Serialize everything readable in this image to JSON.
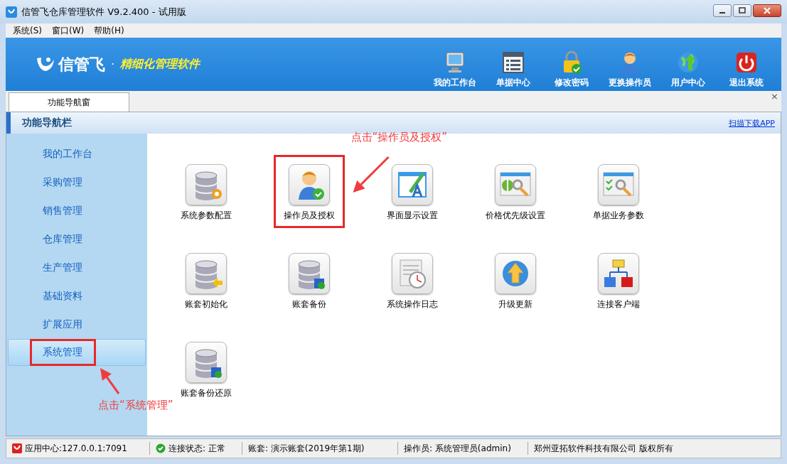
{
  "window": {
    "title": "信管飞仓库管理软件 V9.2.400 - 试用版"
  },
  "menu": [
    "系统(S)",
    "窗口(W)",
    "帮助(H)"
  ],
  "banner": {
    "brand": "信管飞",
    "dot": "·",
    "slogan": "精细化管理软件"
  },
  "toolbar": [
    {
      "label": "我的工作台"
    },
    {
      "label": "单据中心"
    },
    {
      "label": "修改密码"
    },
    {
      "label": "更换操作员"
    },
    {
      "label": "用户中心"
    },
    {
      "label": "退出系统"
    }
  ],
  "tabs": [
    {
      "label": "功能导航窗",
      "selected": true
    }
  ],
  "tab_close": "×",
  "nav_header": {
    "title": "功能导航栏",
    "link": "扫描下载APP"
  },
  "sidebar": {
    "items": [
      {
        "label": "我的工作台",
        "selected": false
      },
      {
        "label": "采购管理",
        "selected": false
      },
      {
        "label": "销售管理",
        "selected": false
      },
      {
        "label": "仓库管理",
        "selected": false
      },
      {
        "label": "生产管理",
        "selected": false
      },
      {
        "label": "基础资料",
        "selected": false
      },
      {
        "label": "扩展应用",
        "selected": false
      },
      {
        "label": "系统管理",
        "selected": true
      }
    ]
  },
  "tiles": [
    {
      "label": "系统参数配置"
    },
    {
      "label": "操作员及授权"
    },
    {
      "label": "界面显示设置"
    },
    {
      "label": "价格优先级设置"
    },
    {
      "label": "单据业务参数"
    },
    {
      "label": "账套初始化"
    },
    {
      "label": "账套备份"
    },
    {
      "label": "系统操作日志"
    },
    {
      "label": "升级更新"
    },
    {
      "label": "连接客户端"
    },
    {
      "label": "账套备份还原"
    }
  ],
  "annotations": [
    {
      "text": "点击“操作员及授权”"
    },
    {
      "text": "点击“系统管理”"
    }
  ],
  "status_bar": [
    {
      "label": "应用中心:127.0.0.1:7091"
    },
    {
      "label": "连接状态: 正常"
    },
    {
      "label": "账套: 演示账套(2019年第1期)"
    },
    {
      "label": "操作员: 系统管理员(admin)"
    },
    {
      "label": "郑州亚拓软件科技有限公司 版权所有"
    }
  ]
}
